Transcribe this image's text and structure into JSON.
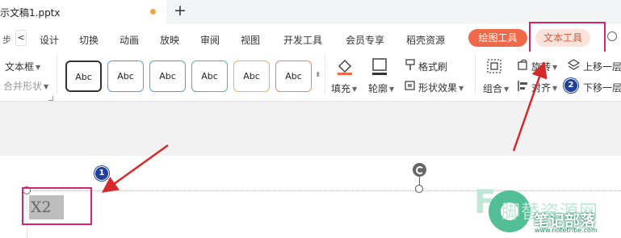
{
  "title_bar": {
    "document_tab": "示文稿1.pptx",
    "new_tab": "+"
  },
  "ribbon_tabs": {
    "nav_left": "步",
    "nav_chevron": "<",
    "items": [
      "设计",
      "切换",
      "动画",
      "放映",
      "审阅",
      "视图",
      "开发工具",
      "会员专享",
      "稻壳资源"
    ],
    "drawing_tools": "绘图工具",
    "text_tools": "文本工具"
  },
  "toolbar": {
    "text_box": "文本框",
    "merge_shapes": "合并形状",
    "style_presets": [
      "Abc",
      "Abc",
      "Abc",
      "Abc",
      "Abc",
      "Abc"
    ],
    "style_border_colors": [
      "#333333",
      "#5b9bd5",
      "#5b9bd5",
      "#49b7a6",
      "#f0b054",
      "#e8836a"
    ],
    "fill": "填充",
    "outline": "轮廓",
    "format_painter": "格式刷",
    "shape_effects": "形状效果",
    "group": "组合",
    "rotate": "旋转",
    "align": "对齐",
    "bring_forward": "上移一层",
    "send_backward": "下移一层"
  },
  "slide": {
    "textbox_content": "X2"
  },
  "annotations": {
    "badge_1": "1",
    "badge_2": "2",
    "highlight_color": "#d6256e",
    "arrow_color": "#d42a2a"
  },
  "watermark": {
    "faded_text": "脚替资源网",
    "main_text": "笔记部落",
    "url": "www.notetribe.com"
  },
  "colors": {
    "drawing_tools_bg": "#ef6a4a",
    "text_tools_bg": "#fbe3dc",
    "text_tools_fg": "#e2553a",
    "badge_bg": "#1e3f9a"
  }
}
